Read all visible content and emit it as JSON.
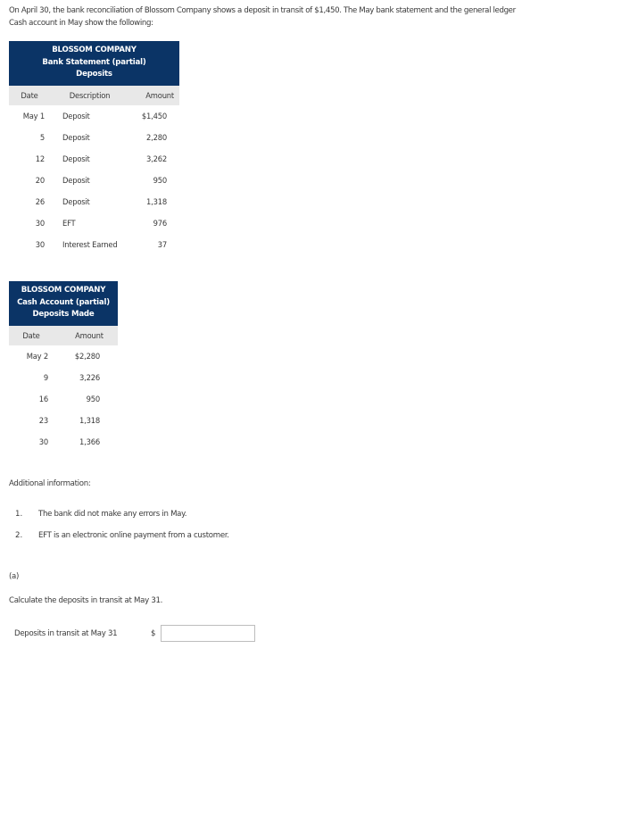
{
  "intro_text": "On April 30, the bank reconciliation of Blossom Company shows a deposit in transit of $1,450. The May bank statement and the general ledger Cash account in May show the following:",
  "bank_statement": {
    "title_line1": "BLOSSOM COMPANY",
    "title_line2": "Bank Statement (partial)",
    "title_line3": "Deposits",
    "headers": {
      "date": "Date",
      "description": "Description",
      "amount": "Amount"
    },
    "rows": [
      {
        "date": "May 1",
        "description": "Deposit",
        "amount": "$1,450"
      },
      {
        "date": "5",
        "description": "Deposit",
        "amount": "2,280"
      },
      {
        "date": "12",
        "description": "Deposit",
        "amount": "3,262"
      },
      {
        "date": "20",
        "description": "Deposit",
        "amount": "950"
      },
      {
        "date": "26",
        "description": "Deposit",
        "amount": "1,318"
      },
      {
        "date": "30",
        "description": "EFT",
        "amount": "976"
      },
      {
        "date": "30",
        "description": "Interest Earned",
        "amount": "37"
      }
    ]
  },
  "cash_account": {
    "title_line1": "BLOSSOM COMPANY",
    "title_line2": "Cash Account (partial)",
    "title_line3": "Deposits Made",
    "headers": {
      "date": "Date",
      "amount": "Amount"
    },
    "rows": [
      {
        "date": "May 2",
        "amount": "$2,280"
      },
      {
        "date": "9",
        "amount": "3,226"
      },
      {
        "date": "16",
        "amount": "950"
      },
      {
        "date": "23",
        "amount": "1,318"
      },
      {
        "date": "30",
        "amount": "1,366"
      }
    ]
  },
  "additional_info": {
    "heading": "Additional information:",
    "items": [
      {
        "num": "1.",
        "text": "The bank did not make any errors in May."
      },
      {
        "num": "2.",
        "text": "EFT is an electronic online payment from a customer."
      }
    ]
  },
  "part_a": {
    "label": "(a)",
    "instruction": "Calculate the deposits in transit at May 31.",
    "field_label": "Deposits in transit at May 31",
    "currency": "$",
    "input_value": ""
  }
}
